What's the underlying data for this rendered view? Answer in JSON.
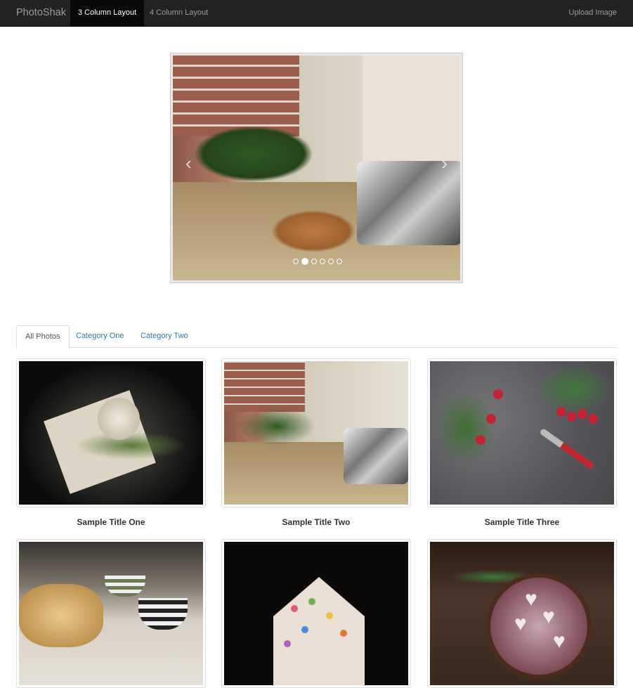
{
  "navbar": {
    "brand": "PhotoShak",
    "items": [
      {
        "label": "3 Column Layout",
        "active": true
      },
      {
        "label": "4 Column Layout",
        "active": false
      }
    ],
    "right_item": "Upload Image"
  },
  "carousel": {
    "prev_glyph": "‹",
    "next_glyph": "›",
    "slide_count": 6,
    "active_index": 1
  },
  "tabs": [
    {
      "label": "All Photos",
      "active": true
    },
    {
      "label": "Category One",
      "active": false
    },
    {
      "label": "Category Two",
      "active": false
    }
  ],
  "gallery": [
    {
      "title": "Sample Title One"
    },
    {
      "title": "Sample Title Two"
    },
    {
      "title": "Sample Title Three"
    },
    {
      "title": ""
    },
    {
      "title": ""
    },
    {
      "title": ""
    }
  ],
  "colors": {
    "navbar_bg": "#222222",
    "nav_active_bg": "#080808",
    "link": "#337ab7"
  }
}
